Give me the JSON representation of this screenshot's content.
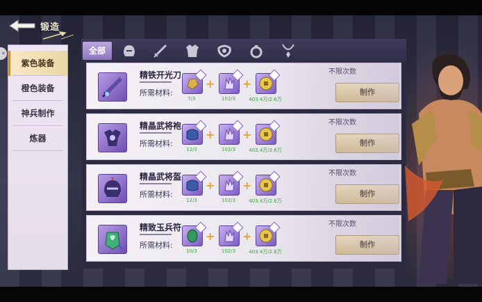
{
  "header": {
    "title": "锻造"
  },
  "sidebar": {
    "items": [
      {
        "label": "紫色装备",
        "active": true
      },
      {
        "label": "橙色装备",
        "active": false
      },
      {
        "label": "神兵制作",
        "active": false
      },
      {
        "label": "炼器",
        "active": false
      }
    ]
  },
  "tabs": {
    "all_label": "全部",
    "icons": [
      "helmet-icon",
      "sword-icon",
      "armor-icon",
      "belt-icon",
      "ring-icon",
      "necklace-icon"
    ]
  },
  "recipes": [
    {
      "name": "精铁开光刀",
      "required_label": "所需材料:",
      "limit_text": "不限次数",
      "craft_label": "制作",
      "materials": [
        {
          "icon": "gold-ore-icon",
          "count": "7/3"
        },
        {
          "icon": "purple-crystal-icon",
          "count": "102/3"
        },
        {
          "icon": "coin-icon",
          "count": "403.4万/2.6万"
        }
      ]
    },
    {
      "name": "精晶武将袍",
      "required_label": "所需材料:",
      "limit_text": "不限次数",
      "craft_label": "制作",
      "materials": [
        {
          "icon": "blue-cloth-icon",
          "count": "12/3"
        },
        {
          "icon": "purple-crystal-icon",
          "count": "102/3"
        },
        {
          "icon": "coin-icon",
          "count": "403.4万/2.6万"
        }
      ]
    },
    {
      "name": "精晶武将盔",
      "required_label": "所需材料:",
      "limit_text": "不限次数",
      "craft_label": "制作",
      "materials": [
        {
          "icon": "blue-cloth-icon",
          "count": "12/3"
        },
        {
          "icon": "purple-crystal-icon",
          "count": "102/3"
        },
        {
          "icon": "coin-icon",
          "count": "403.4万/2.6万"
        }
      ]
    },
    {
      "name": "精致玉兵符",
      "required_label": "所需材料:",
      "limit_text": "不限次数",
      "craft_label": "制作",
      "materials": [
        {
          "icon": "jade-icon",
          "count": "10/3"
        },
        {
          "icon": "purple-crystal-icon",
          "count": "102/3"
        },
        {
          "icon": "coin-icon",
          "count": "403.4万/2.6万"
        }
      ]
    }
  ]
}
